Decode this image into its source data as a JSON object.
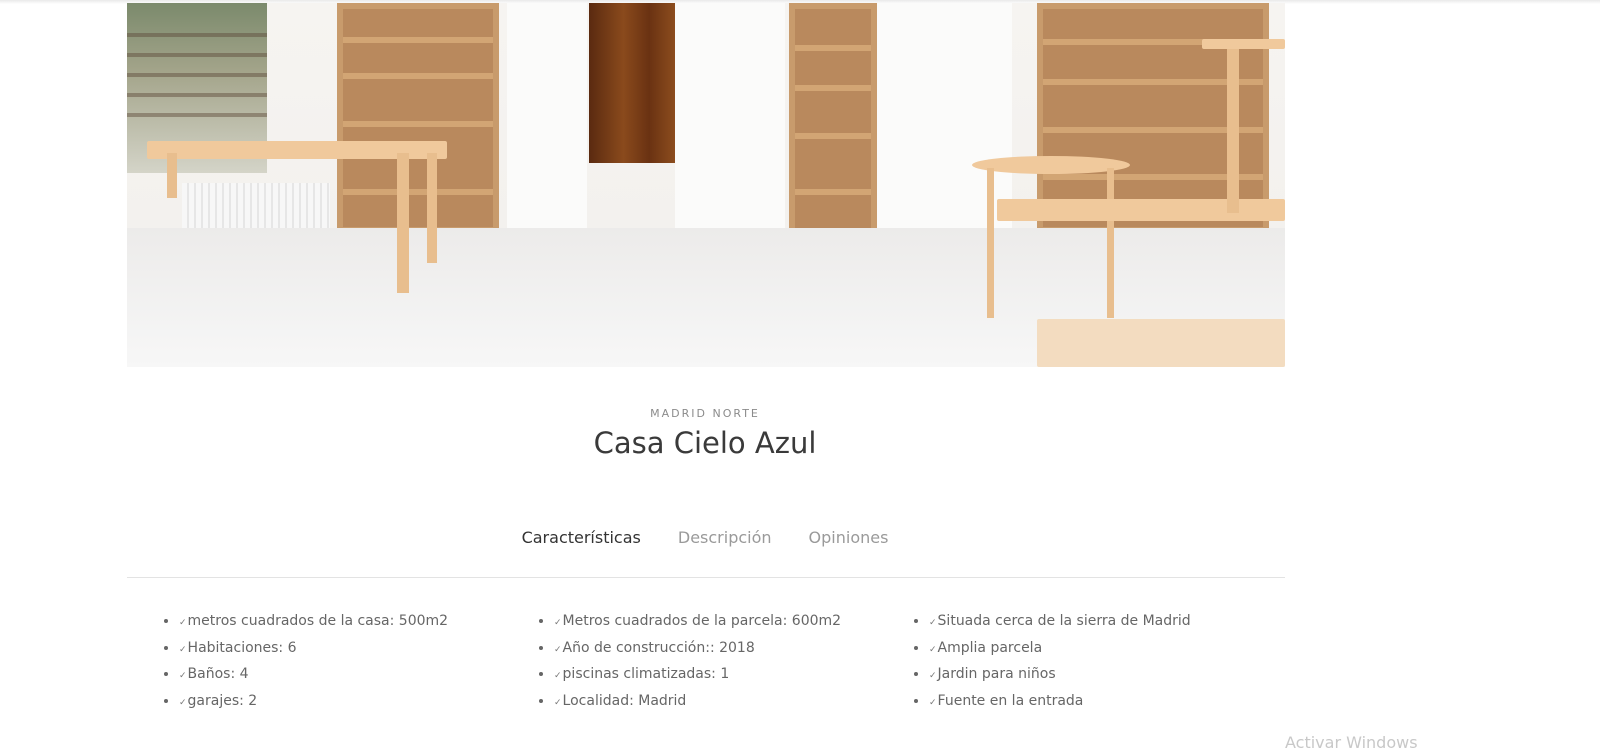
{
  "property": {
    "location": "MADRID NORTE",
    "name": "Casa Cielo Azul"
  },
  "tabs": [
    {
      "label": "Características",
      "active": true
    },
    {
      "label": "Descripción",
      "active": false
    },
    {
      "label": "Opiniones",
      "active": false
    }
  ],
  "features": {
    "check_glyph": "✓",
    "columns": [
      [
        "metros cuadrados de la casa: 500m2",
        "Habitaciones: 6",
        "Baños: 4",
        "garajes: 2"
      ],
      [
        "Metros cuadrados de la parcela: 600m2",
        "Año de construcción:: 2018",
        "piscinas climatizadas: 1",
        "Localidad: Madrid"
      ],
      [
        "Situada cerca de la sierra de Madrid",
        "Amplia parcela",
        "Jardin para niños",
        "Fuente en la entrada"
      ]
    ]
  },
  "watermark": "Activar Windows",
  "colors": {
    "accent_text": "#333333",
    "muted_text": "#9a9a9a",
    "wood": "#c89b6c"
  }
}
